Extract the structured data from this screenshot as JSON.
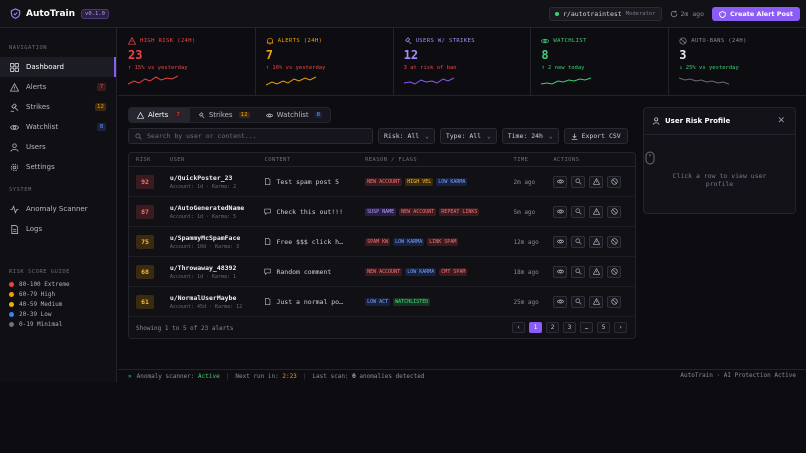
{
  "app": {
    "name": "AutoTrain",
    "version": "v0.1.0"
  },
  "top": {
    "subreddit": "r/autotraintest",
    "role": "Moderator",
    "refreshed": "2m ago",
    "create_label": "Create Alert Post"
  },
  "sidebar": {
    "nav_title": "NAVIGATION",
    "items": [
      {
        "label": "Dashboard",
        "icon": "grid-icon",
        "badge": ""
      },
      {
        "label": "Alerts",
        "icon": "warning-icon",
        "badge": "7"
      },
      {
        "label": "Strikes",
        "icon": "gavel-icon",
        "badge": "12"
      },
      {
        "label": "Watchlist",
        "icon": "eye-icon",
        "badge": "8"
      },
      {
        "label": "Users",
        "icon": "user-icon",
        "badge": ""
      },
      {
        "label": "Settings",
        "icon": "gear-icon",
        "badge": ""
      }
    ],
    "system_title": "SYSTEM",
    "system_items": [
      {
        "label": "Anomaly Scanner",
        "icon": "pulse-icon"
      },
      {
        "label": "Logs",
        "icon": "document-icon"
      }
    ],
    "risk_title": "RISK SCORE GUIDE",
    "risk_guide": [
      {
        "label": "80-100 Extreme",
        "color": "#ef4444"
      },
      {
        "label": "60-79 High",
        "color": "#f59e0b"
      },
      {
        "label": "40-59 Medium",
        "color": "#eab308"
      },
      {
        "label": "20-39 Low",
        "color": "#3b82f6"
      },
      {
        "label": "0-19 Minimal",
        "color": "#6b7280"
      }
    ]
  },
  "stats": [
    {
      "label": "HIGH RISK (24H)",
      "value": "23",
      "delta": "↑ 15% vs yesterday",
      "color": "#ef4444",
      "delta_color": "#ef4444"
    },
    {
      "label": "ALERTS (24H)",
      "value": "7",
      "delta": "↑ 16% vs yesterday",
      "color": "#f59e0b",
      "delta_color": "#ef4444"
    },
    {
      "label": "USERS W/ STRIKES",
      "value": "12",
      "delta": "3 at risk of ban",
      "color": "#8b5cf6",
      "delta_color": "#ef4444"
    },
    {
      "label": "WATCHLIST",
      "value": "8",
      "delta": "↑ 2 new today",
      "color": "#3ecf74",
      "delta_color": "#3ecf74"
    },
    {
      "label": "AUTO-BANS (24H)",
      "value": "3",
      "delta": "↓ 25% vs yesterday",
      "color": "#8a8a98",
      "delta_color": "#3ecf74"
    }
  ],
  "tabs": [
    {
      "label": "Alerts",
      "count": "7"
    },
    {
      "label": "Strikes",
      "count": "12"
    },
    {
      "label": "Watchlist",
      "count": "8"
    }
  ],
  "filters": {
    "search_placeholder": "Search by user or content...",
    "risk": "Risk: All",
    "type": "Type: All",
    "time": "Time: 24h",
    "export_label": "Export CSV"
  },
  "table": {
    "headers": [
      "RISK",
      "USER",
      "CONTENT",
      "REASON / FLAGS",
      "TIME",
      "ACTIONS"
    ],
    "rows": [
      {
        "risk": "92",
        "risk_color": "#ef4444",
        "user": "u/QuickPoster_23",
        "meta": "Account: 1d · Karma: 2",
        "content": "Test spam post 5",
        "ctype": "post",
        "tags": [
          {
            "t": "NEW ACCOUNT",
            "c": "red"
          },
          {
            "t": "HIGH VEL",
            "c": "amber"
          },
          {
            "t": "LOW KARMA",
            "c": "blue"
          }
        ],
        "time": "2m ago"
      },
      {
        "risk": "87",
        "risk_color": "#ef4444",
        "user": "u/AutoGeneratedName",
        "meta": "Account: 1d · Karma: 5",
        "content": "Check this out!!!",
        "ctype": "comment",
        "tags": [
          {
            "t": "SUSP NAME",
            "c": "purple"
          },
          {
            "t": "NEW ACCOUNT",
            "c": "red"
          },
          {
            "t": "REPEAT LINKS",
            "c": "red"
          }
        ],
        "time": "5m ago"
      },
      {
        "risk": "75",
        "risk_color": "#f59e0b",
        "user": "u/SpammyMcSpamFace",
        "meta": "Account: 10d · Karma: 3",
        "content": "Free $$$ click h…",
        "ctype": "post",
        "tags": [
          {
            "t": "SPAM KW",
            "c": "red"
          },
          {
            "t": "LOW KARMA",
            "c": "blue"
          },
          {
            "t": "LINK SPAM",
            "c": "red"
          }
        ],
        "time": "12m ago"
      },
      {
        "risk": "68",
        "risk_color": "#f59e0b",
        "user": "u/Throwaway_48392",
        "meta": "Account: 1d · Karma: 1",
        "content": "Random comment",
        "ctype": "comment",
        "tags": [
          {
            "t": "NEW ACCOUNT",
            "c": "red"
          },
          {
            "t": "LOW KARMA",
            "c": "blue"
          },
          {
            "t": "CMT SPAM",
            "c": "red"
          }
        ],
        "time": "18m ago"
      },
      {
        "risk": "61",
        "risk_color": "#f59e0b",
        "user": "u/NormalUserMaybe",
        "meta": "Account: 45d · Karma: 12",
        "content": "Just a normal po…",
        "ctype": "post",
        "tags": [
          {
            "t": "LOW ACT",
            "c": "blue"
          },
          {
            "t": "WATCHLISTED",
            "c": "green"
          }
        ],
        "time": "25m ago"
      }
    ],
    "footer": "Showing 1 to 5 of 23 alerts",
    "pages": [
      "‹",
      "1",
      "2",
      "3",
      "…",
      "5",
      "›"
    ]
  },
  "profile": {
    "title": "User Risk Profile",
    "empty": "Click a row to view user profile"
  },
  "status": {
    "scanner_label": "Anomaly scanner:",
    "scanner_value": "Active",
    "next_label": "Next run in:",
    "next_value": "2:23",
    "last_label": "Last scan:",
    "last_value": "0",
    "last_suffix": "anomalies detected",
    "right": "AutoTrain · AI Protection Active"
  }
}
